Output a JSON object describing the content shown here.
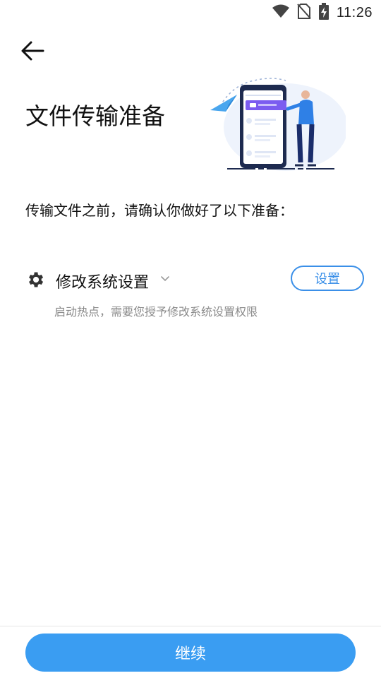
{
  "status_bar": {
    "time": "11:26",
    "icons": [
      "wifi-icon",
      "no-sim-icon",
      "battery-charging-icon"
    ]
  },
  "nav": {
    "back_icon": "arrow-left-icon"
  },
  "page": {
    "title": "文件传输准备",
    "intro": "传输文件之前，请确认你做好了以下准备："
  },
  "permission": {
    "icon": "gear-icon",
    "title": "修改系统设置",
    "expand_icon": "chevron-down-icon",
    "button_label": "设置",
    "description": "启动热点，需要您授予修改系统设置权限"
  },
  "footer": {
    "continue_label": "继续"
  },
  "colors": {
    "accent": "#3a9df2",
    "accent_outline": "#3a8fe8",
    "secondary_text": "#8a8a8a",
    "illustration_purple": "#7b5cf0"
  }
}
